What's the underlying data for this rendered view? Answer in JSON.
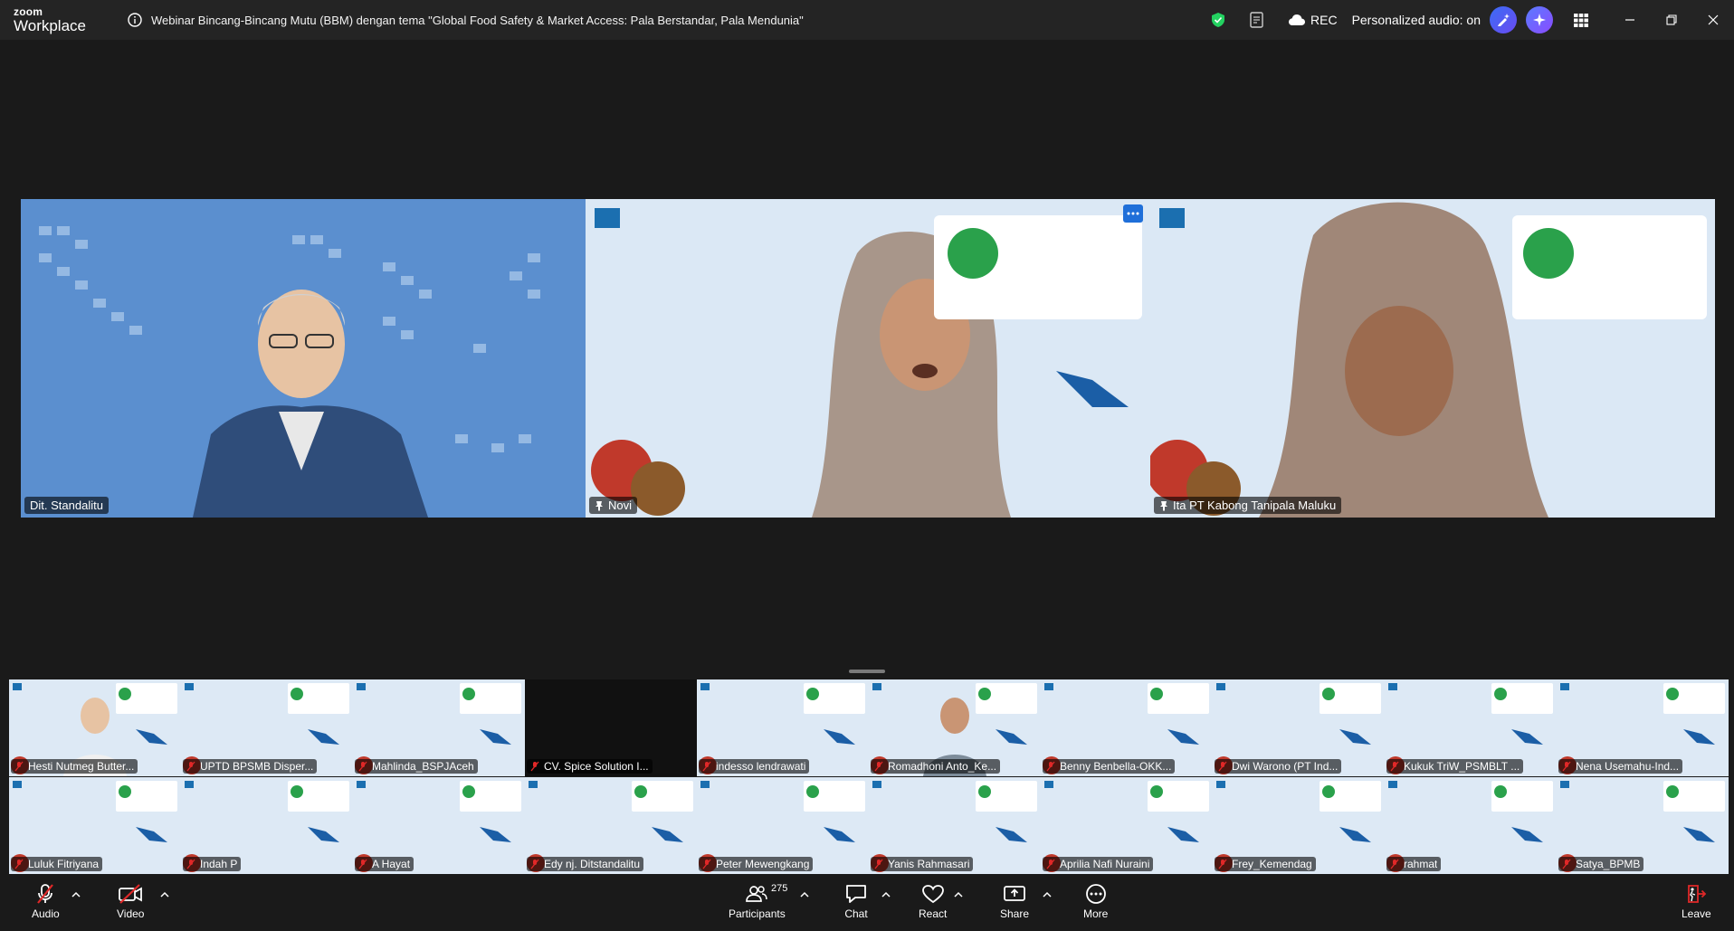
{
  "app": {
    "logo_top": "zoom",
    "logo_bottom": "Workplace",
    "meeting_title": "Webinar Bincang-Bincang Mutu (BBM) dengan tema \"Global Food Safety & Market Access: Pala Berstandar, Pala Mendunia\"",
    "rec_label": "REC",
    "audio_status": "Personalized audio: on"
  },
  "colors": {
    "active_speaker": "#23d160",
    "bg": "#1a1a1a",
    "topbar": "#242424"
  },
  "main_tiles": [
    {
      "name": "Dit. Standalitu",
      "active": true,
      "muted": false
    },
    {
      "name": "Novi",
      "active": false,
      "muted": false
    },
    {
      "name": "Ita PT Kabong Tanipala Maluku",
      "active": false,
      "muted": false
    }
  ],
  "thumbnails": [
    {
      "name": "Hesti Nutmeg Butter..."
    },
    {
      "name": "UPTD BPSMB Disper..."
    },
    {
      "name": "Mahlinda_BSPJAceh"
    },
    {
      "name": "CV. Spice Solution I..."
    },
    {
      "name": "indesso lendrawati"
    },
    {
      "name": "Romadhoni Anto_Ke..."
    },
    {
      "name": "Benny Benbella-OKK..."
    },
    {
      "name": "Dwi Warono (PT Ind..."
    },
    {
      "name": "Kukuk TriW_PSMBLT ..."
    },
    {
      "name": "Nena Usemahu-Ind..."
    },
    {
      "name": "Luluk Fitriyana"
    },
    {
      "name": "Indah P"
    },
    {
      "name": "A Hayat"
    },
    {
      "name": "Edy nj. Ditstandalitu"
    },
    {
      "name": "Peter Mewengkang"
    },
    {
      "name": "Yanis Rahmasari"
    },
    {
      "name": "Aprilia Nafi Nuraini"
    },
    {
      "name": "Frey_Kemendag"
    },
    {
      "name": "rahmat"
    },
    {
      "name": "Satya_BPMB"
    }
  ],
  "toolbar": {
    "audio_label": "Audio",
    "video_label": "Video",
    "participants_label": "Participants",
    "participants_count": "275",
    "chat_label": "Chat",
    "react_label": "React",
    "share_label": "Share",
    "more_label": "More",
    "leave_label": "Leave"
  }
}
